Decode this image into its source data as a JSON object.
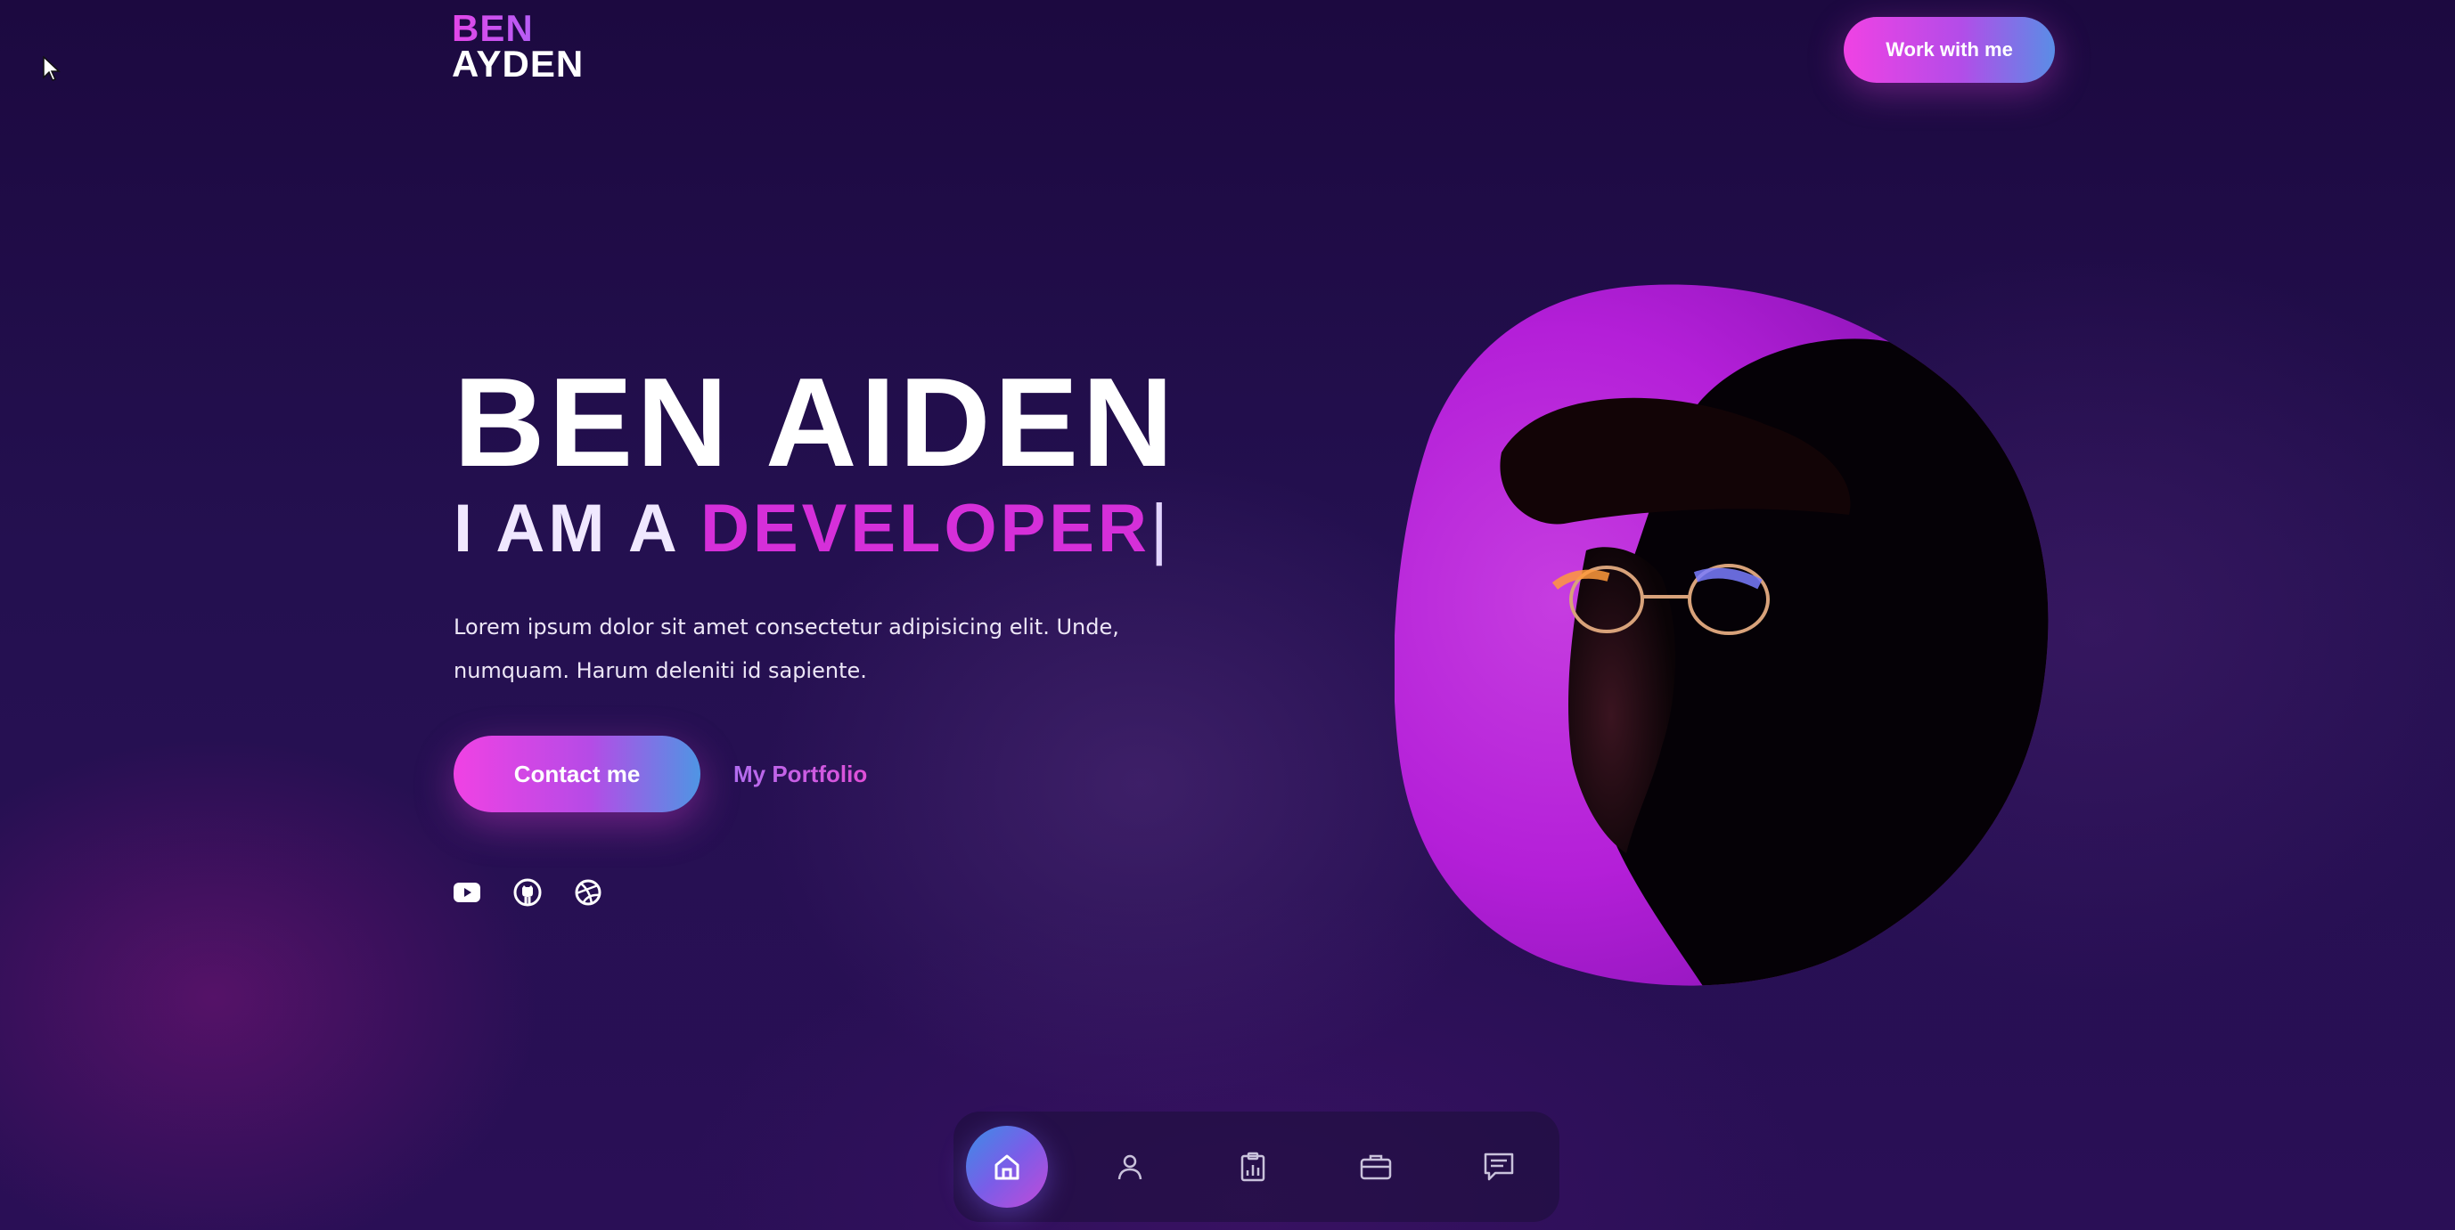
{
  "header": {
    "logo_line1": "BEN",
    "logo_line2": "AYDEN",
    "cta_label": "Work with me"
  },
  "hero": {
    "name": "BEN AIDEN",
    "role_prefix": "I AM A",
    "role_typed": "DEVELOPER",
    "caret": "|",
    "description": "Lorem ipsum dolor sit amet consectetur adipisicing elit. Unde, numquam. Harum deleniti id sapiente.",
    "contact_label": "Contact me",
    "portfolio_label": "My Portfolio"
  },
  "socials": [
    {
      "icon": "youtube-icon"
    },
    {
      "icon": "github-icon"
    },
    {
      "icon": "dribbble-icon"
    }
  ],
  "bottom_nav": [
    {
      "icon": "home-icon",
      "active": true
    },
    {
      "icon": "user-icon",
      "active": false
    },
    {
      "icon": "clipboard-chart-icon",
      "active": false
    },
    {
      "icon": "briefcase-icon",
      "active": false
    },
    {
      "icon": "message-icon",
      "active": false
    }
  ],
  "colors": {
    "background": "#1f0b45",
    "accent_pink": "#d52fd9",
    "accent_blue": "#4f95e4",
    "text": "#ffffff"
  }
}
